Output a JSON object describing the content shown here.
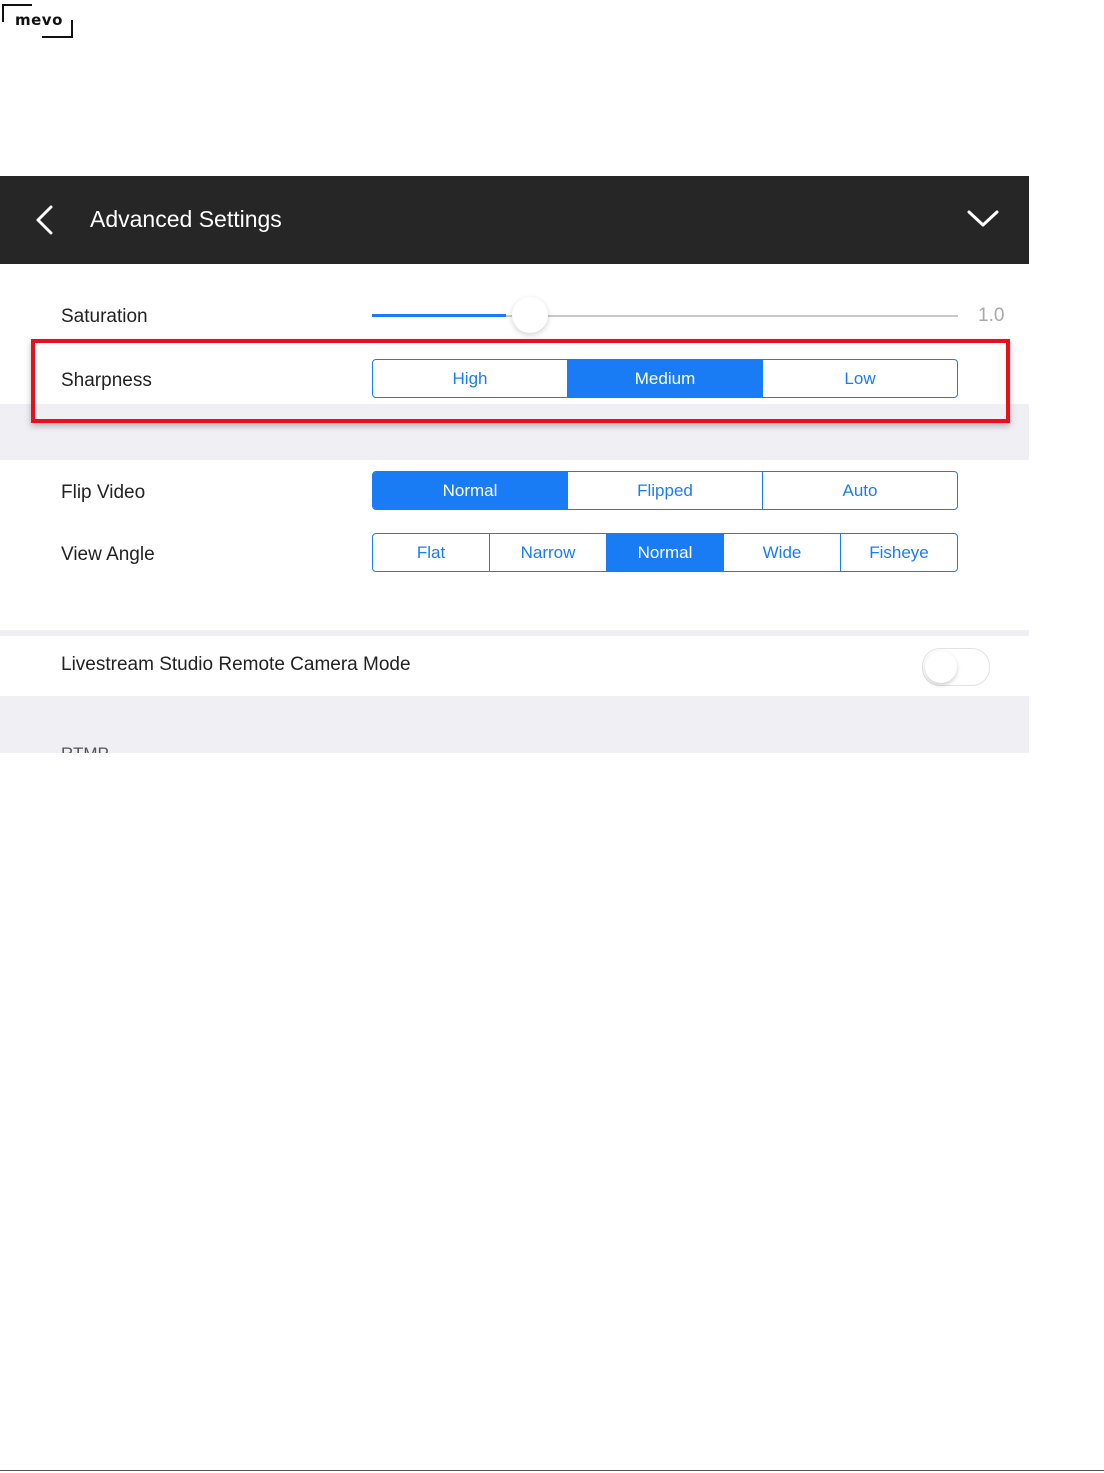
{
  "logo": {
    "text": "mevo"
  },
  "header": {
    "title": "Advanced Settings"
  },
  "saturation": {
    "label": "Saturation",
    "value_text": "1.0",
    "level_percent": 27
  },
  "sharpness": {
    "label": "Sharpness",
    "options": [
      "High",
      "Medium",
      "Low"
    ],
    "selected_index": 1
  },
  "flip_video": {
    "label": "Flip Video",
    "options": [
      "Normal",
      "Flipped",
      "Auto"
    ],
    "selected_index": 0
  },
  "view_angle": {
    "label": "View Angle",
    "options": [
      "Flat",
      "Narrow",
      "Normal",
      "Wide",
      "Fisheye"
    ],
    "selected_index": 2
  },
  "remote_mode": {
    "label": "Livestream Studio Remote Camera Mode",
    "enabled": false
  },
  "next_section_header_partial": "RTMP",
  "colors": {
    "accent": "#1a7cf5",
    "header_bg": "#262626",
    "highlight": "#e8101c",
    "group_bg": "#efeff4"
  },
  "icons": [
    "chevron-left-icon",
    "chevron-down-icon"
  ]
}
